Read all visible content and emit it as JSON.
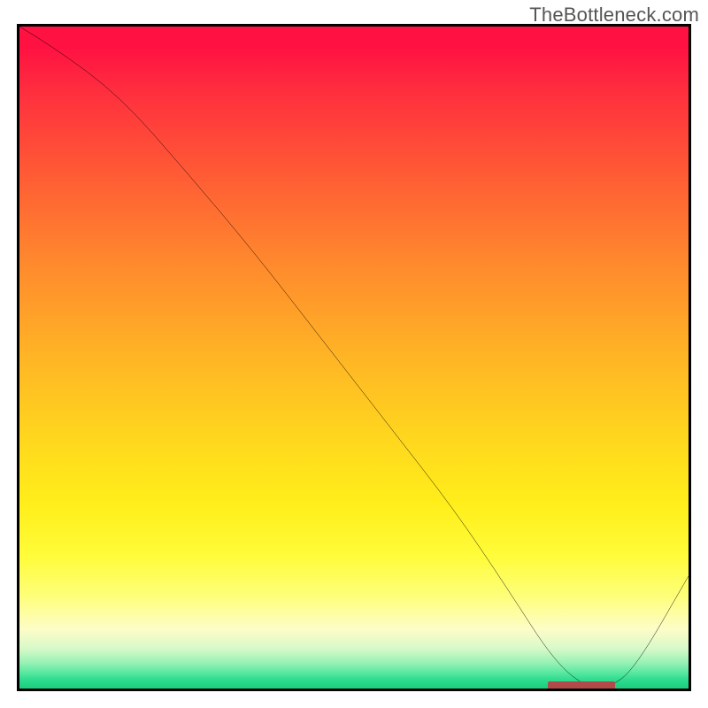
{
  "watermark": "TheBottleneck.com",
  "colors": {
    "frame": "#000000",
    "curve": "#000000",
    "marker": "#B24A4A"
  },
  "chart_data": {
    "type": "line",
    "title": "",
    "xlabel": "",
    "ylabel": "",
    "xlim": [
      0,
      100
    ],
    "ylim": [
      0,
      100
    ],
    "grid": false,
    "x": [
      0,
      5,
      15,
      25,
      35,
      45,
      55,
      65,
      73,
      80,
      85,
      88,
      92,
      100
    ],
    "values": [
      100,
      97,
      89.5,
      78,
      66,
      53,
      40,
      27,
      15,
      4,
      0,
      0,
      3,
      17
    ],
    "marker_region": {
      "x_start": 79,
      "x_end": 89,
      "y": 0.4
    },
    "gradient_stops": [
      {
        "pct": 0,
        "color": "#FF1142"
      },
      {
        "pct": 10,
        "color": "#FF2F3E"
      },
      {
        "pct": 22,
        "color": "#FF5A35"
      },
      {
        "pct": 36,
        "color": "#FF8A2D"
      },
      {
        "pct": 50,
        "color": "#FFB525"
      },
      {
        "pct": 62,
        "color": "#FFD61E"
      },
      {
        "pct": 72,
        "color": "#FFEE1A"
      },
      {
        "pct": 80,
        "color": "#FFFC3A"
      },
      {
        "pct": 86,
        "color": "#FEFE7A"
      },
      {
        "pct": 91,
        "color": "#FDFDC7"
      },
      {
        "pct": 94,
        "color": "#D7F9C9"
      },
      {
        "pct": 96,
        "color": "#9BF2B6"
      },
      {
        "pct": 97.5,
        "color": "#5DE9A2"
      },
      {
        "pct": 98.7,
        "color": "#2DDC8E"
      },
      {
        "pct": 100,
        "color": "#1CCD7E"
      }
    ]
  }
}
